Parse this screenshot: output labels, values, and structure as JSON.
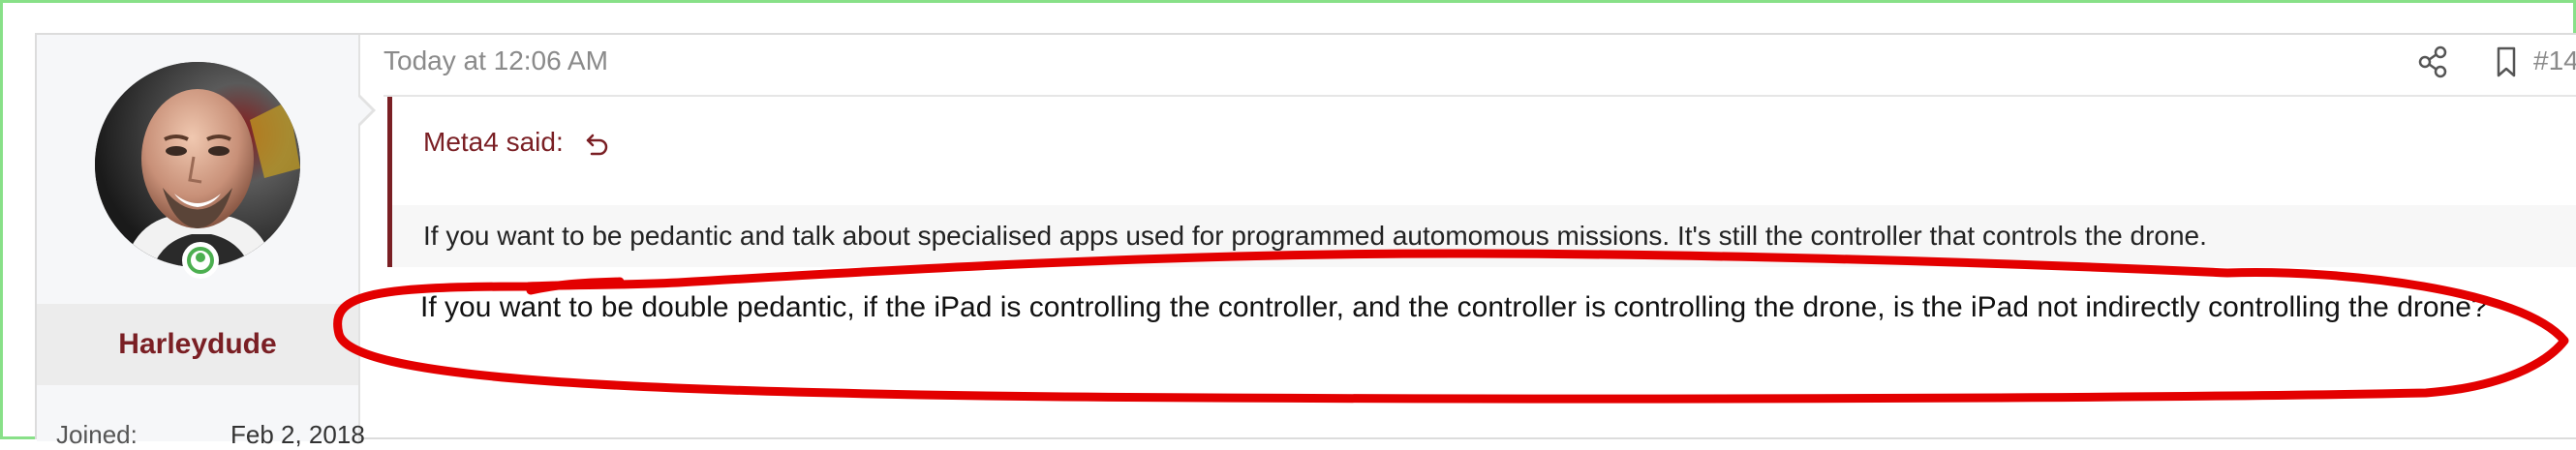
{
  "post": {
    "date": "Today at 12:06 AM",
    "number": "#14",
    "share_icon": "share-icon",
    "bookmark_icon": "bookmark-icon"
  },
  "user": {
    "name": "Harleydude",
    "joined_label": "Joined:",
    "joined_value": "Feb 2, 2018",
    "status": "online",
    "status_color": "#4caf50"
  },
  "quote": {
    "author_said": "Meta4 said:",
    "expand_icon": "return-arrow-icon",
    "text": "If you want to be pedantic and talk about specialised apps used for programmed automomous missions. It's still the controller that controls the drone."
  },
  "message": {
    "text": "If you want to be double pedantic, if the iPad is controlling the controller, and the controller is controlling the drone, is the iPad not indirectly controlling the drone?"
  },
  "colors": {
    "accent": "#7a1f24",
    "annotation": "#e30000",
    "frame": "#88e088"
  }
}
